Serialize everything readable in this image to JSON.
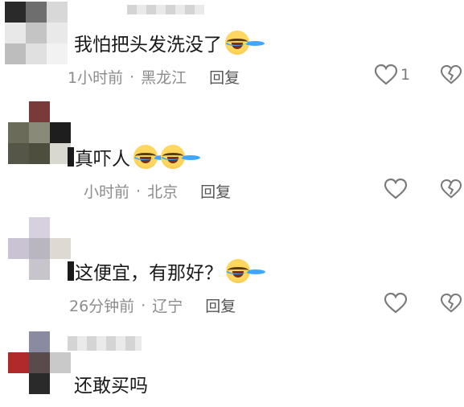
{
  "comments": [
    {
      "text": "我怕把头发洗没了",
      "emoji": "laugh-cry-emoji",
      "time": "1小时前",
      "dot": "·",
      "location": "黑龙江",
      "reply": "回复",
      "likes": "1"
    },
    {
      "text": "真吓人",
      "emoji_count": 2,
      "time": "小时前",
      "dot": "·",
      "location": "北京",
      "reply": "回复",
      "likes": ""
    },
    {
      "text": "这便宜，有那好？",
      "emoji": "laugh-cry-emoji",
      "time": "26分钟前",
      "dot": "·",
      "location": "辽宁",
      "reply": "回复",
      "likes": ""
    },
    {
      "text": "还敢买吗",
      "time": "",
      "location": "",
      "reply": ""
    }
  ],
  "icons": {
    "like": "heart-outline-icon",
    "dislike": "broken-heart-icon"
  },
  "colors": {
    "text": "#1a1a1a",
    "meta": "#8c8c8c",
    "icon": "#7a7a7a"
  }
}
